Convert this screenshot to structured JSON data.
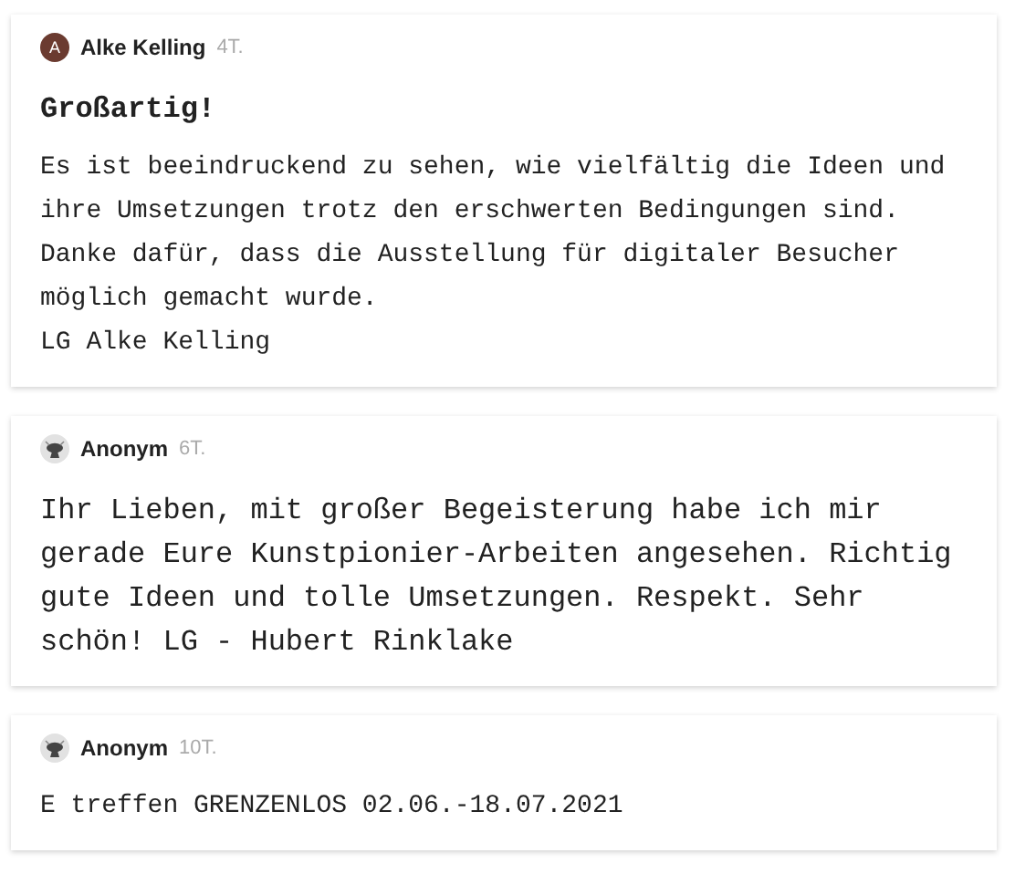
{
  "comments": [
    {
      "author": "Alke Kelling",
      "avatar": {
        "kind": "letter",
        "text": "A"
      },
      "time": "4T.",
      "title": "Großartig!",
      "kind": "normal",
      "lines": [
        "Es ist beeindruckend zu sehen, wie vielfältig die Ideen und ihre Umsetzungen trotz den erschwerten Bedingungen sind.",
        "Danke dafür, dass die Ausstellung für digitaler Besucher möglich gemacht wurde.",
        "LG Alke Kelling"
      ]
    },
    {
      "author": "Anonym",
      "avatar": {
        "kind": "anonymous"
      },
      "time": "6T.",
      "kind": "large",
      "lines": [
        "Ihr Lieben, mit großer Begeisterung habe ich mir gerade Eure Kunstpionier-Arbeiten angesehen. Richtig gute Ideen und tolle Umsetzungen. Respekt. Sehr schön! LG - Hubert Rinklake"
      ]
    },
    {
      "author": "Anonym",
      "avatar": {
        "kind": "anonymous"
      },
      "time": "10T.",
      "kind": "normal",
      "lines": [
        "E treffen GRENZENLOS 02.06.-18.07.2021"
      ]
    }
  ]
}
